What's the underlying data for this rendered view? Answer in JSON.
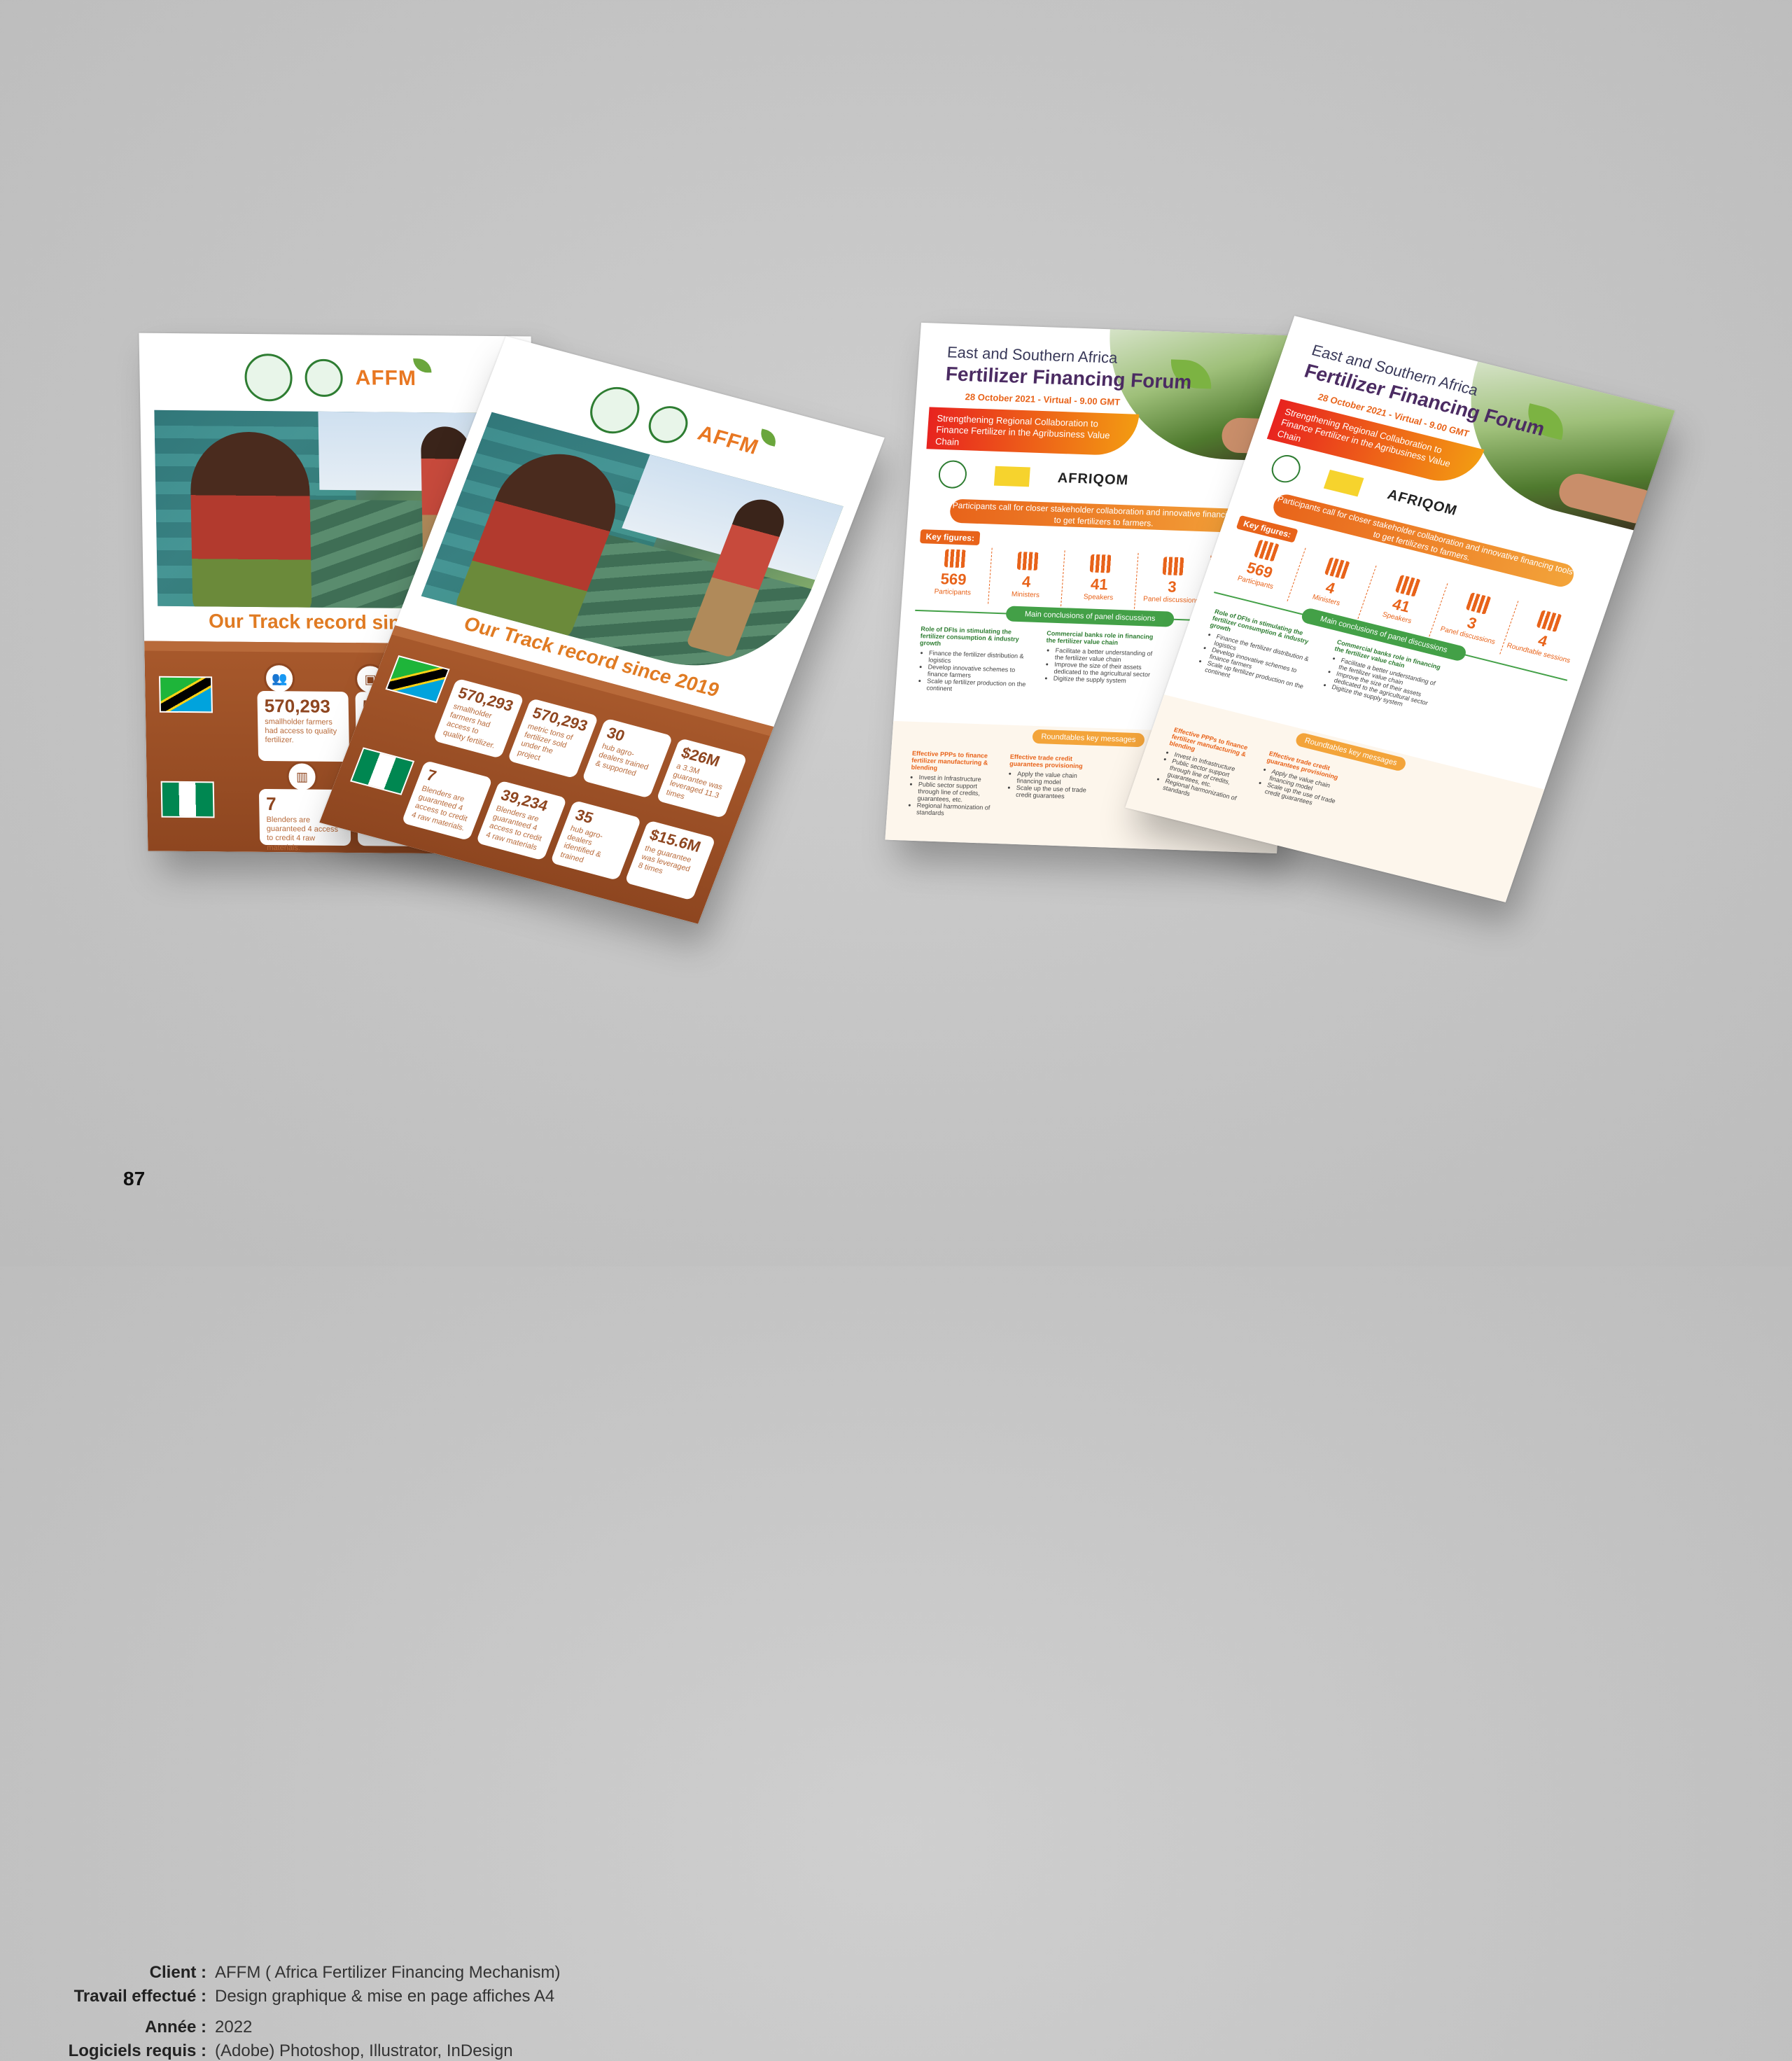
{
  "posters": {
    "track": {
      "logo_text": "AFFM",
      "title": "Our Track record since 2019",
      "stats": {
        "s1_num": "570,293",
        "s1_desc": "smallholder farmers had access to quality fertilizer.",
        "s2_num": "570,293",
        "s2_desc": "metric tons of fertilizer sold under the project",
        "s3_num": "30",
        "s3_desc": "hub agro-dealers trained & supported",
        "s4_num": "$26M",
        "s4_desc": "a 3.3M guarantee was leveraged 11.3 times",
        "s5_num": "7",
        "s5_desc": "Blenders are guaranteed 4 access to credit 4 raw materials.",
        "s6_num": "39,234",
        "s6_desc": "Blenders are guaranteed 4 access to credit 4 raw materials",
        "s7_num": "35",
        "s7_desc": "hub agro-dealers identified & trained",
        "s8_num": "$15.6M",
        "s8_desc": "the guarantee was leveraged 8 times",
        "s6_short": "39"
      }
    },
    "forum": {
      "title_line1": "East and Southern Africa",
      "title_line2": "Fertilizer Financing Forum",
      "date": "28 October 2021 - Virtual - 9.00 GMT",
      "ribbon": "Strengthening Regional Collaboration to Finance Fertilizer in the Agribusiness Value Chain",
      "afriqom": "AFRIQOM",
      "call": "Participants call for closer stakeholder collaboration and innovative financing tools to get fertilizers to farmers.",
      "key_figures_label": "Key figures:",
      "key_figures": [
        {
          "num": "569",
          "label": "Participants"
        },
        {
          "num": "4",
          "label": "Ministers"
        },
        {
          "num": "41",
          "label": "Speakers"
        },
        {
          "num": "3",
          "label": "Panel discussions"
        },
        {
          "num": "4",
          "label": "Roundtable sessions"
        }
      ],
      "main_conclusions": "Main conclusions of panel discussions",
      "col1_title": "Role of DFIs in stimulating the fertilizer consumption & industry growth",
      "col1_items": [
        "Finance the fertilizer distribution & logistics",
        "Develop innovative schemes to finance farmers",
        "Scale up fertilizer production on the continent"
      ],
      "col2_title": "Commercial banks role in financing the fertilizer value chain",
      "col2_items": [
        "Facilitate a better understanding of the fertilizer value chain",
        "Improve the size of their assets dedicated to the agricultural sector",
        "Digitize the supply system"
      ],
      "roundtables": "Roundtables key messages",
      "l1_title": "Effective PPPs to finance fertilizer manufacturing & blending",
      "l1_items": [
        "Invest in Infrastructure",
        "Public sector support through line of credits, guarantees, etc.",
        "Regional harmonization of standards"
      ],
      "l2_title": "Effective trade credit guarantees provisioning",
      "l2_items": [
        "Apply the value chain financing model",
        "Scale up the use of trade credit guarantees"
      ]
    }
  },
  "caption": {
    "client_key": "Client :",
    "client_val": "AFFM ( Africa Fertilizer Financing Mechanism)",
    "work_key": "Travail effectué :",
    "work_val": "Design graphique & mise en page  affiches A4",
    "year_key": "Année :",
    "year_val": "2022",
    "software_key": "Logiciels requis :",
    "software_val": "(Adobe) Photoshop, Illustrator, InDesign"
  },
  "page_number": "87",
  "colors": {
    "brown": "#8e4620",
    "orange": "#e8631a",
    "green": "#43a047",
    "purple": "#4b2b62"
  }
}
